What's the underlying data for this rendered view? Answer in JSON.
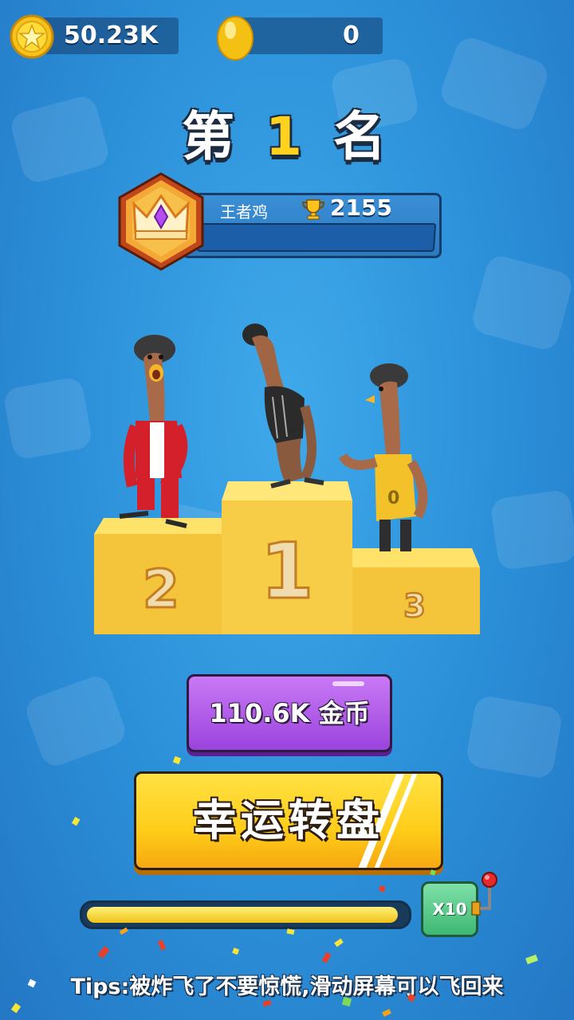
{
  "top_bar": {
    "coins": "50.23K",
    "eggs": "0",
    "coin_icon": "star-coin-icon",
    "egg_icon": "golden-egg-icon"
  },
  "rank": {
    "prefix": "第",
    "number": "1",
    "suffix": "名"
  },
  "player": {
    "name": "王者鸡",
    "trophies": "2155",
    "badge_icon": "crown-gem-badge-icon"
  },
  "podium": {
    "first": "1",
    "second": "2",
    "third": "3"
  },
  "reward_button": {
    "label": "110.6K 金币"
  },
  "spin_button": {
    "label": "幸运转盘"
  },
  "multiplier": {
    "label": "X10",
    "progress": 0.98
  },
  "tips": "Tips:被炸飞了不要惊慌,滑动屏幕可以飞回来",
  "colors": {
    "accent_yellow": "#ffd21f",
    "purple_button": "#b35ae8",
    "green_button": "#54c985"
  }
}
